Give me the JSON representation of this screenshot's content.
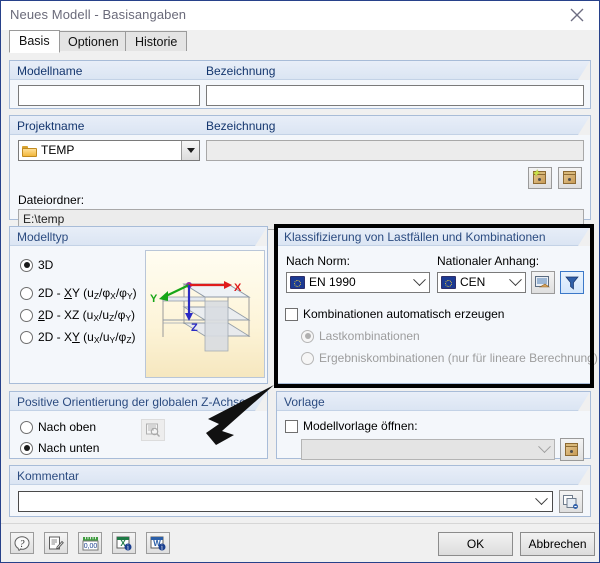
{
  "window": {
    "title": "Neues Modell - Basisangaben",
    "close_icon": "close-icon"
  },
  "tabs": [
    {
      "label": "Basis",
      "active": true
    },
    {
      "label": "Optionen",
      "active": false
    },
    {
      "label": "Historie",
      "active": false
    }
  ],
  "model_name_group": {
    "name_label": "Modellname",
    "name_value": "",
    "desc_label": "Bezeichnung",
    "desc_value": ""
  },
  "project_group": {
    "name_label": "Projektname",
    "name_value": "TEMP",
    "name_icon": "folder-icon",
    "desc_label": "Bezeichnung",
    "desc_value": "",
    "folder_label": "Dateiordner:",
    "folder_value": "E:\\temp",
    "new_project_button": "new-project-icon",
    "open_project_button": "open-project-icon"
  },
  "model_type_group": {
    "title": "Modelltyp",
    "options": [
      {
        "label": "3D",
        "sub": "",
        "checked": true
      },
      {
        "label": "2D - XY",
        "sub": "(u_Z/φ_X/φ_Y)",
        "checked": false
      },
      {
        "label": "2D - XZ",
        "sub": "(u_X/u_Z/φ_Y)",
        "checked": false
      },
      {
        "label": "2D - XY",
        "sub": "(u_X/u_Y/φ_Z)",
        "checked": false
      }
    ],
    "preview": {
      "axis_x": "X",
      "axis_y": "Y",
      "axis_z": "Z",
      "color_x": "#e01b1b",
      "color_y": "#17a617",
      "color_z": "#2b2bc4"
    }
  },
  "classification_group": {
    "title": "Klassifizierung von Lastfällen und Kombinationen",
    "standard_label": "Nach Norm:",
    "standard_value": "EN 1990",
    "standard_icon": "eu-flag-icon",
    "annex_label": "Nationaler Anhang:",
    "annex_value": "CEN",
    "annex_icon": "eu-flag-icon",
    "edit_button": "edit-annex-icon",
    "filter_button": "filter-icon",
    "auto_combos_label": "Kombinationen automatisch erzeugen",
    "auto_combos_checked": false,
    "sub_options": [
      {
        "label": "Lastkombinationen",
        "checked": true,
        "disabled": true
      },
      {
        "label": "Ergebniskombinationen (nur für lineare Berechnung)",
        "checked": false,
        "disabled": true
      }
    ]
  },
  "z_axis_group": {
    "title": "Positive Orientierung der globalen Z-Achse",
    "options": [
      {
        "label": "Nach oben",
        "checked": false
      },
      {
        "label": "Nach unten",
        "checked": true
      }
    ],
    "preview_button": "preview-icon"
  },
  "template_group": {
    "title": "Vorlage",
    "checkbox_label": "Modellvorlage öffnen:",
    "checkbox_checked": false,
    "combo_value": "",
    "browse_button": "open-template-icon"
  },
  "comment_group": {
    "title": "Kommentar",
    "value": "",
    "picker_button": "comment-list-icon"
  },
  "bottom_toolbar": [
    {
      "name": "help-icon"
    },
    {
      "name": "edit-note-icon"
    },
    {
      "name": "units-icon"
    },
    {
      "name": "excel-export-icon"
    },
    {
      "name": "word-export-icon"
    }
  ],
  "dialog_buttons": {
    "ok": "OK",
    "cancel": "Abbrechen"
  },
  "colors": {
    "group_title": "#2b4b80",
    "field_label": "#14366e",
    "window_border": "#27418a",
    "accent_highlight": "#3b78c8"
  }
}
